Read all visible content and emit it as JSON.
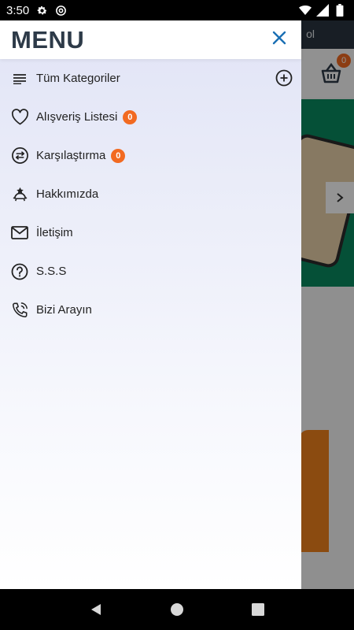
{
  "status_bar": {
    "time": "3:50",
    "left_icons": [
      "gear-icon",
      "at-sign-icon"
    ],
    "right_icons": [
      "wifi-icon",
      "signal-icon",
      "battery-icon"
    ]
  },
  "background": {
    "topbar_text": "ol",
    "cart_count": "0"
  },
  "drawer": {
    "title": "MENU",
    "items": [
      {
        "label": "Tüm Kategoriler",
        "icon": "list-icon"
      },
      {
        "label": "Alışveriş Listesi",
        "icon": "heart-icon",
        "badge": "0"
      },
      {
        "label": "Karşılaştırma",
        "icon": "compare-arrows-icon",
        "badge": "0"
      },
      {
        "label": "Hakkımızda",
        "icon": "award-ribbon-icon"
      },
      {
        "label": "İletişim",
        "icon": "mail-icon"
      },
      {
        "label": "S.S.S",
        "icon": "question-circle-icon"
      },
      {
        "label": "Bizi Arayın",
        "icon": "phone-call-icon"
      }
    ]
  },
  "colors": {
    "accent": "#1a6fb4",
    "badge": "#f26a21",
    "title": "#2d3a48"
  }
}
